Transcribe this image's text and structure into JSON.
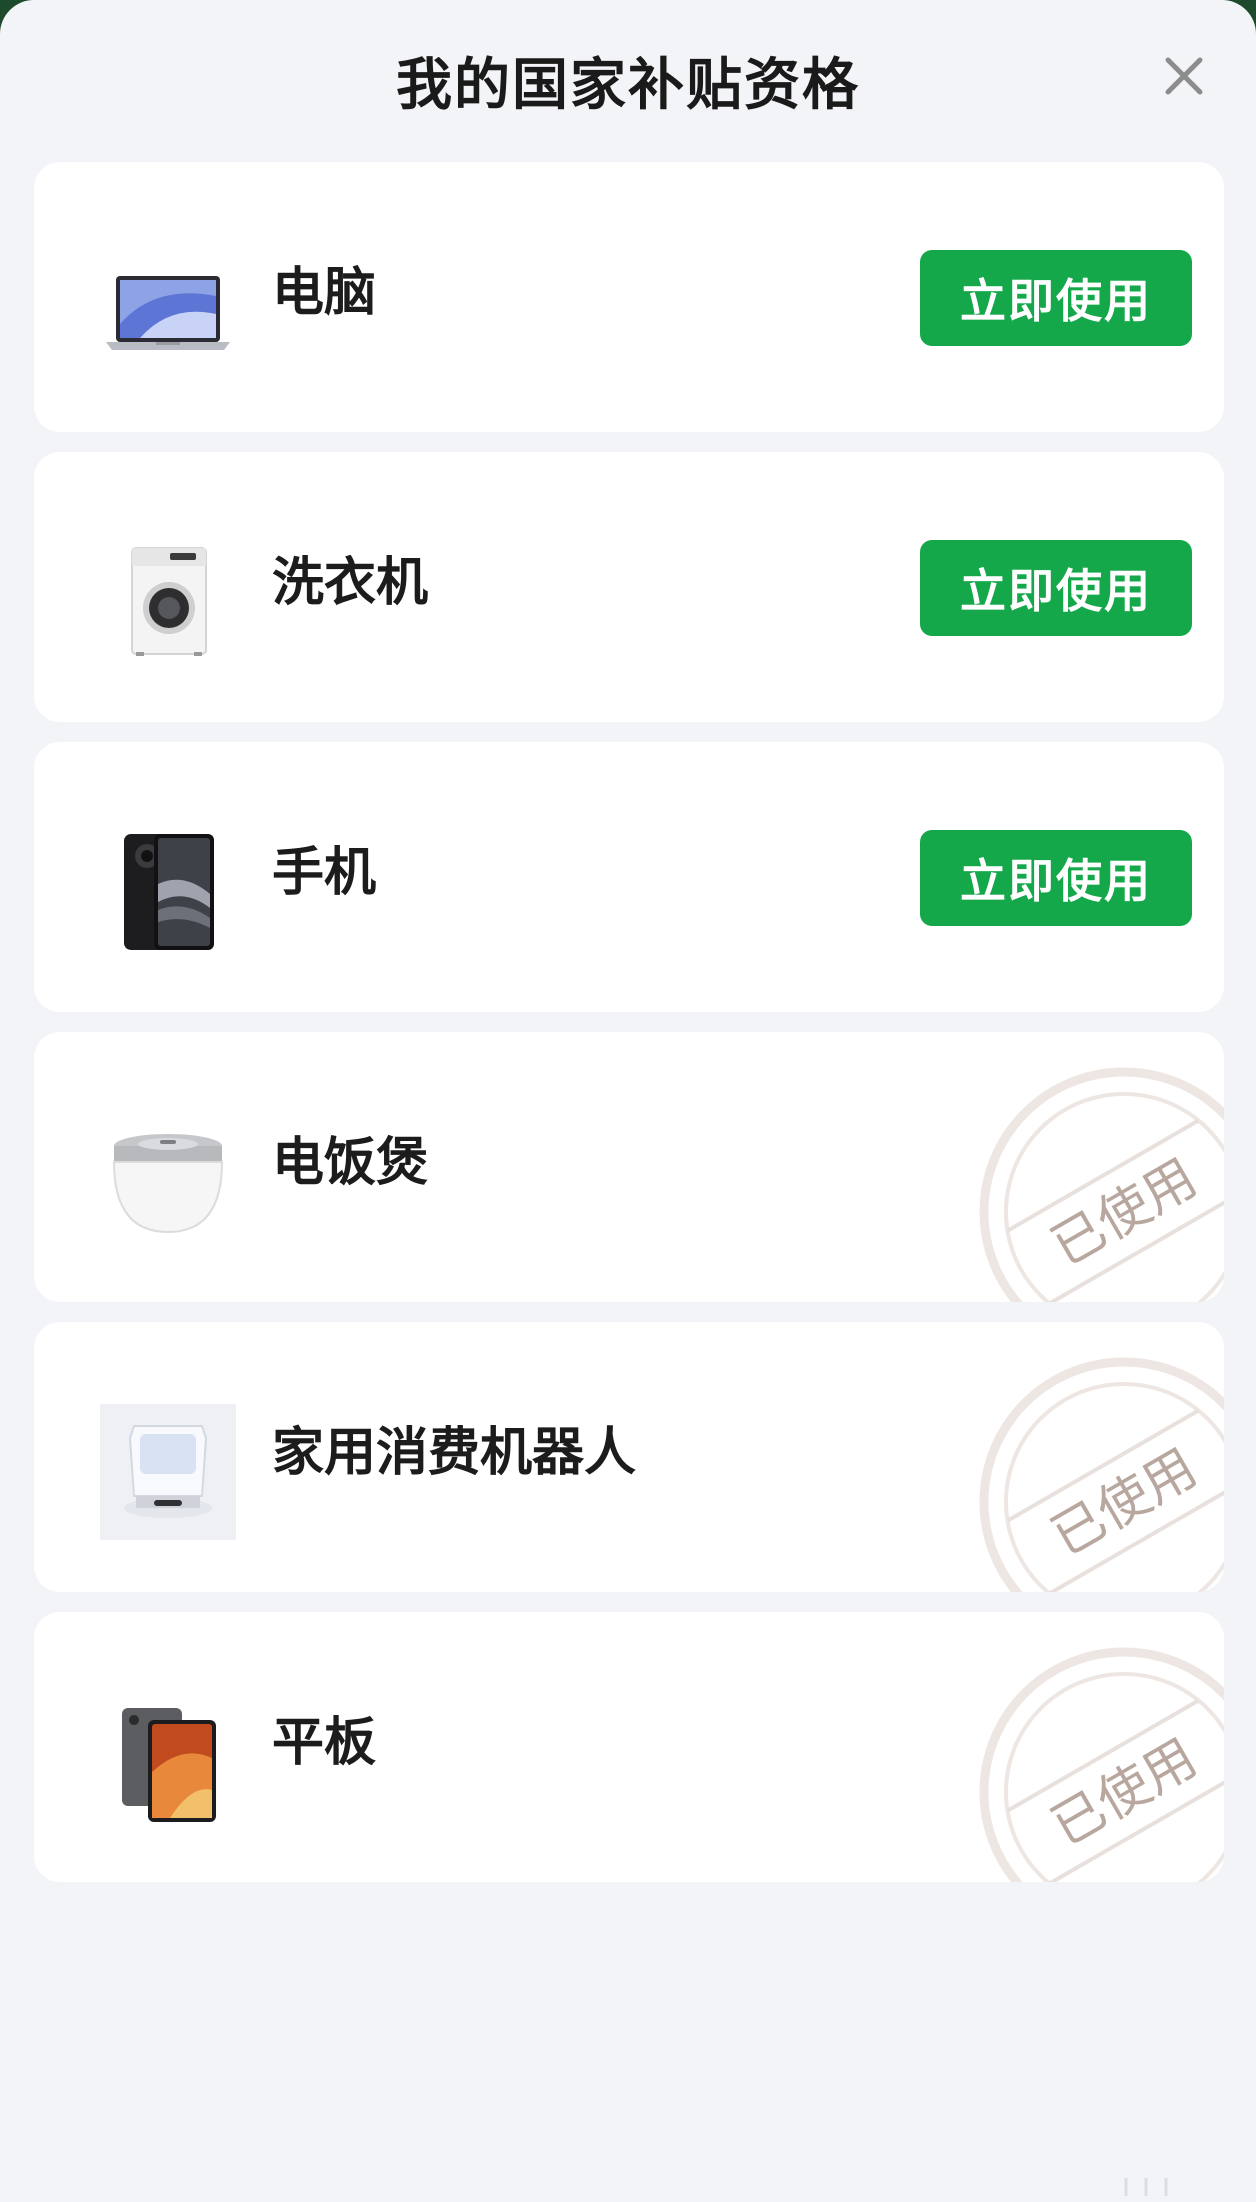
{
  "header": {
    "title": "我的国家补贴资格"
  },
  "items": [
    {
      "name": "电脑",
      "icon": "laptop-icon",
      "status": "available",
      "action_label": "立即使用"
    },
    {
      "name": "洗衣机",
      "icon": "washing-machine-icon",
      "status": "available",
      "action_label": "立即使用"
    },
    {
      "name": "手机",
      "icon": "phone-icon",
      "status": "available",
      "action_label": "立即使用"
    },
    {
      "name": "电饭煲",
      "icon": "rice-cooker-icon",
      "status": "used",
      "stamp_label": "已使用"
    },
    {
      "name": "家用消费机器人",
      "icon": "robot-vacuum-icon",
      "status": "used",
      "stamp_label": "已使用"
    },
    {
      "name": "平板",
      "icon": "tablet-icon",
      "status": "used",
      "stamp_label": "已使用"
    }
  ],
  "colors": {
    "accent": "#14a84a",
    "background": "#f3f4f8",
    "card": "#ffffff",
    "stamp": "#b8a79e"
  }
}
